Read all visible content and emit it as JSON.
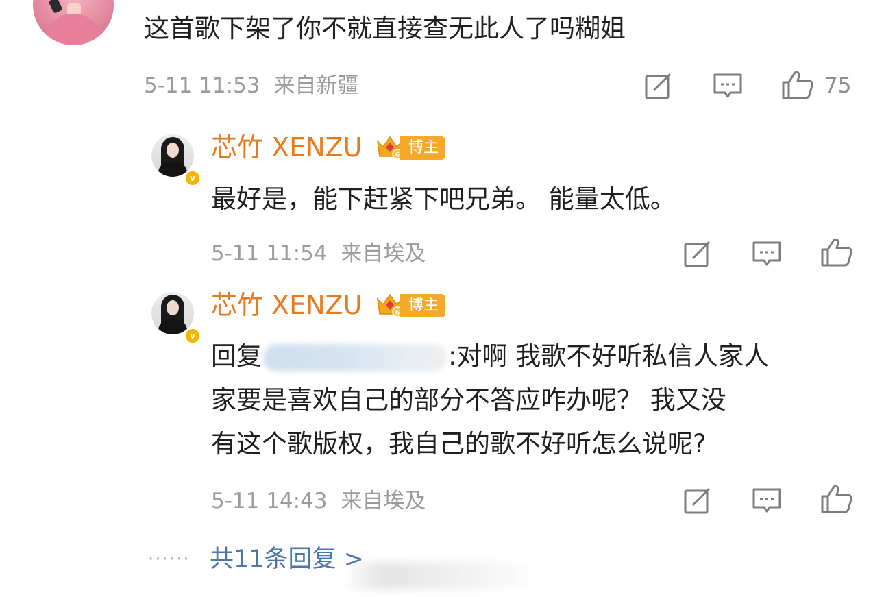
{
  "comment": {
    "text": "这首歌下架了你不就直接查无此人了吗糊姐",
    "time": "5-11 11:53",
    "source": "来自新疆",
    "like_count": "75"
  },
  "replies": [
    {
      "username": "芯竹 XENZU",
      "badge_label": "博主",
      "badge_level": "6",
      "text_lines": [
        "最好是，能下赶紧下吧兄弟。 能量太低。"
      ],
      "time": "5-11 11:54",
      "source": "来自埃及"
    },
    {
      "username": "芯竹 XENZU",
      "badge_label": "博主",
      "badge_level": "6",
      "reply_prefix": "回复",
      "reply_after_mention": ":对啊 我歌不好听私信人家人",
      "text_lines": [
        "家要是喜欢自己的部分不答应咋办呢？ 我又没",
        "有这个歌版权，我自己的歌不好听怎么说呢?"
      ],
      "time": "5-11 14:43",
      "source": "来自埃及"
    }
  ],
  "footer": {
    "dots": "······",
    "more_replies": "共11条回复 >"
  },
  "icons": {
    "share": "share-icon",
    "comment": "comment-icon",
    "like": "thumbs-up-icon",
    "verified": "verified-badge-icon",
    "crown": "crown-badge-icon"
  },
  "colors": {
    "username": "#e8791c",
    "link": "#4a76a8",
    "meta": "#9b9b9b",
    "badge": "#f6a828"
  }
}
